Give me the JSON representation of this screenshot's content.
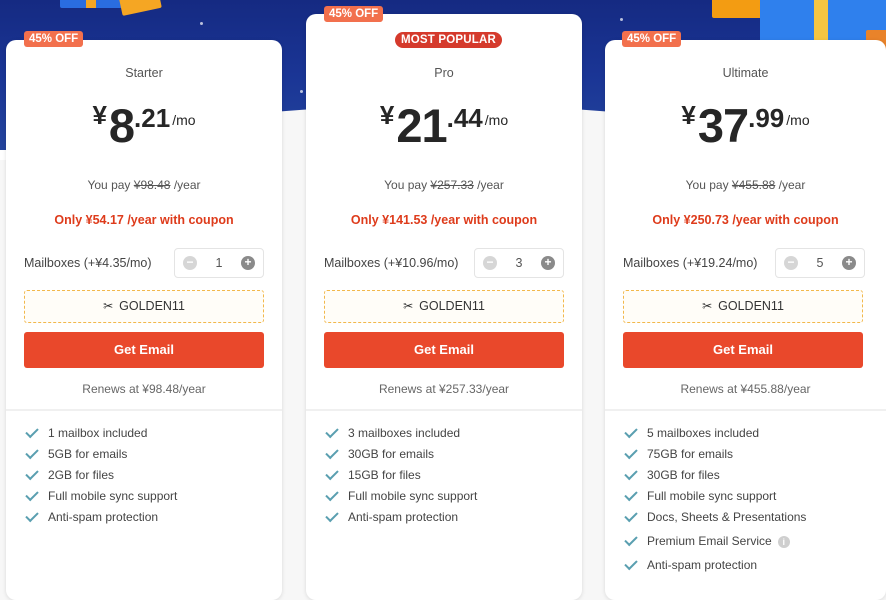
{
  "theme": {
    "accent": "#e9482b",
    "coupon_text": "#de3b1b",
    "badge_off": "#f2704d",
    "badge_popular": "#d53a2c",
    "header_bg": "#1a3595",
    "check_color": "#5a9fb0"
  },
  "plans": [
    {
      "discount_badge": "45% OFF",
      "name": "Starter",
      "currency": "¥",
      "price_int": "8",
      "price_dec": ".21",
      "per": "/mo",
      "pay_prefix": "You pay",
      "pay_strike": "¥98.48",
      "pay_suffix": "/year",
      "coupon_offer": "Only ¥54.17 /year with coupon",
      "mailboxes_label": "Mailboxes (+¥4.35/mo)",
      "mailbox_count": "1",
      "coupon_code": "GOLDEN11",
      "cta": "Get Email",
      "renews": "Renews at ¥98.48/year",
      "features": [
        "1 mailbox included",
        "5GB for emails",
        "2GB for files",
        "Full mobile sync support",
        "Anti-spam protection"
      ]
    },
    {
      "discount_badge": "45% OFF",
      "popular_badge": "MOST POPULAR",
      "name": "Pro",
      "currency": "¥",
      "price_int": "21",
      "price_dec": ".44",
      "per": "/mo",
      "pay_prefix": "You pay",
      "pay_strike": "¥257.33",
      "pay_suffix": "/year",
      "coupon_offer": "Only ¥141.53 /year with coupon",
      "mailboxes_label": "Mailboxes (+¥10.96/mo)",
      "mailbox_count": "3",
      "coupon_code": "GOLDEN11",
      "cta": "Get Email",
      "renews": "Renews at ¥257.33/year",
      "features": [
        "3 mailboxes included",
        "30GB for emails",
        "15GB for files",
        "Full mobile sync support",
        "Anti-spam protection"
      ]
    },
    {
      "discount_badge": "45% OFF",
      "name": "Ultimate",
      "currency": "¥",
      "price_int": "37",
      "price_dec": ".99",
      "per": "/mo",
      "pay_prefix": "You pay",
      "pay_strike": "¥455.88",
      "pay_suffix": "/year",
      "coupon_offer": "Only ¥250.73 /year with coupon",
      "mailboxes_label": "Mailboxes (+¥19.24/mo)",
      "mailbox_count": "5",
      "coupon_code": "GOLDEN11",
      "cta": "Get Email",
      "renews": "Renews at ¥455.88/year",
      "features": [
        "5 mailboxes included",
        "75GB for emails",
        "30GB for files",
        "Full mobile sync support",
        "Docs, Sheets & Presentations",
        "Premium Email Service",
        "Anti-spam protection"
      ]
    }
  ],
  "icons": {
    "scissors": "✂",
    "minus": "−",
    "plus": "+",
    "info": "i"
  }
}
